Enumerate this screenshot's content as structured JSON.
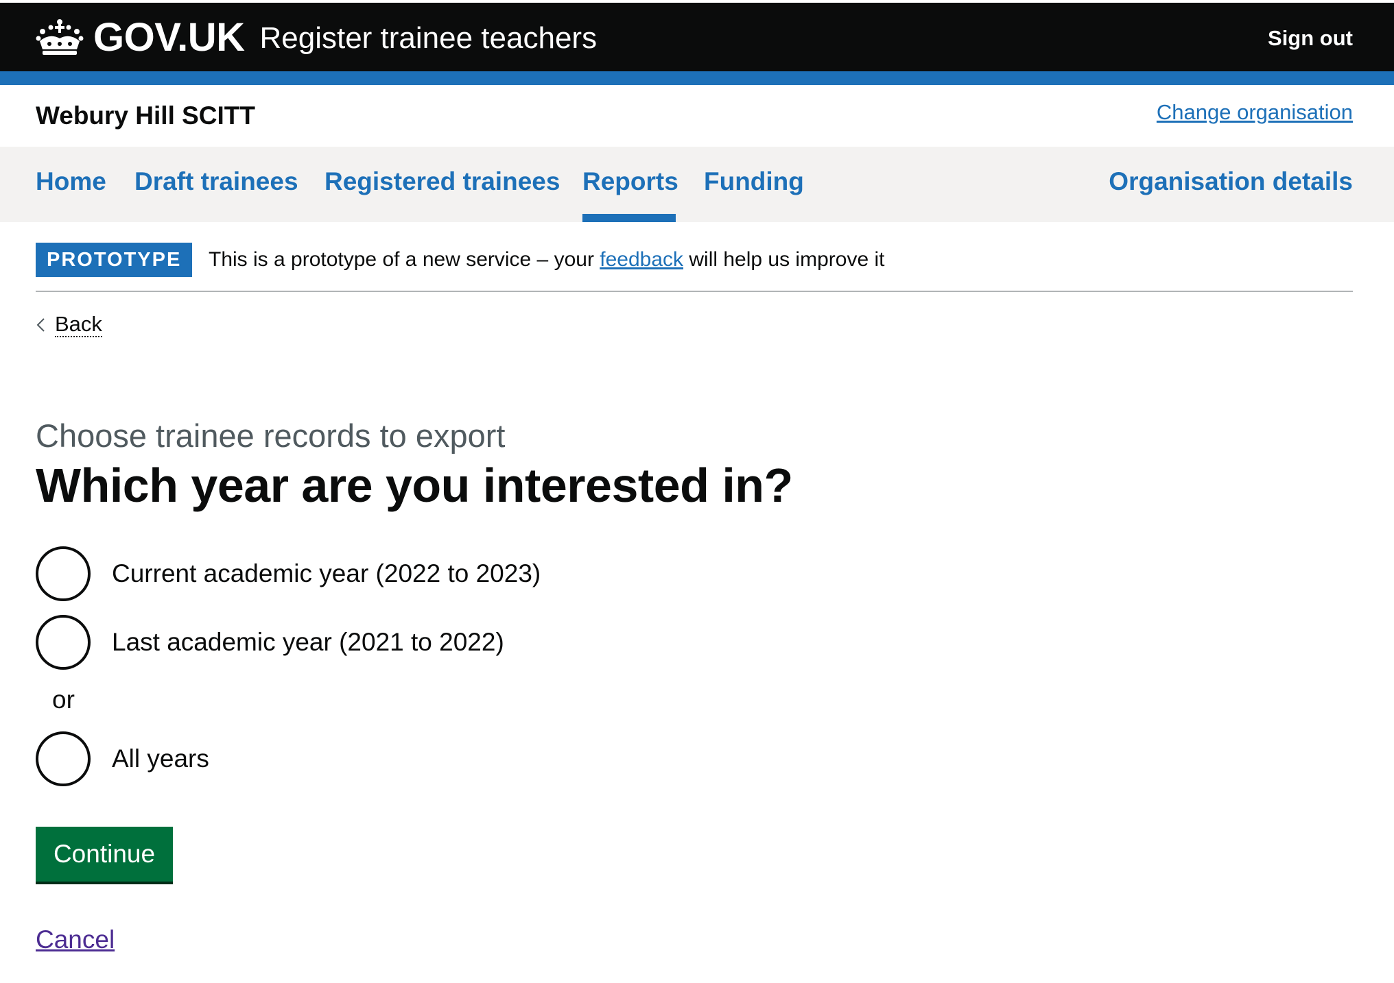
{
  "header": {
    "brand": "GOV.UK",
    "service_name": "Register trainee teachers",
    "sign_out_label": "Sign out",
    "crown_icon": "crown-logo-icon"
  },
  "organisation": {
    "name": "Webury Hill SCITT",
    "change_label": "Change organisation"
  },
  "nav": {
    "items": [
      {
        "label": "Home",
        "active": false
      },
      {
        "label": "Draft trainees",
        "active": false
      },
      {
        "label": "Registered trainees",
        "active": false
      },
      {
        "label": "Reports",
        "active": true
      },
      {
        "label": "Funding",
        "active": false
      }
    ],
    "right_item": "Organisation details"
  },
  "banner": {
    "tag": "PROTOTYPE",
    "text_before": "This is a prototype of a new service – your ",
    "link_text": "feedback",
    "text_after": " will help us improve it"
  },
  "back_link": {
    "label": "Back",
    "icon": "chevron-left-icon"
  },
  "question": {
    "caption": "Choose trainee records to export",
    "heading": "Which year are you interested in?",
    "options": [
      {
        "label": "Current academic year (2022 to 2023)",
        "checked": false
      },
      {
        "label": "Last academic year (2021 to 2022)",
        "checked": false
      }
    ],
    "divider": "or",
    "alt_option": {
      "label": "All years",
      "checked": false
    }
  },
  "actions": {
    "continue_label": "Continue",
    "cancel_label": "Cancel"
  },
  "colors": {
    "header_bg": "#0b0c0c",
    "brand_blue": "#1d70b8",
    "nav_bg": "#f3f2f1",
    "button_green": "#00703c",
    "visited_link": "#4c2c92",
    "caption_grey": "#505a5f"
  }
}
